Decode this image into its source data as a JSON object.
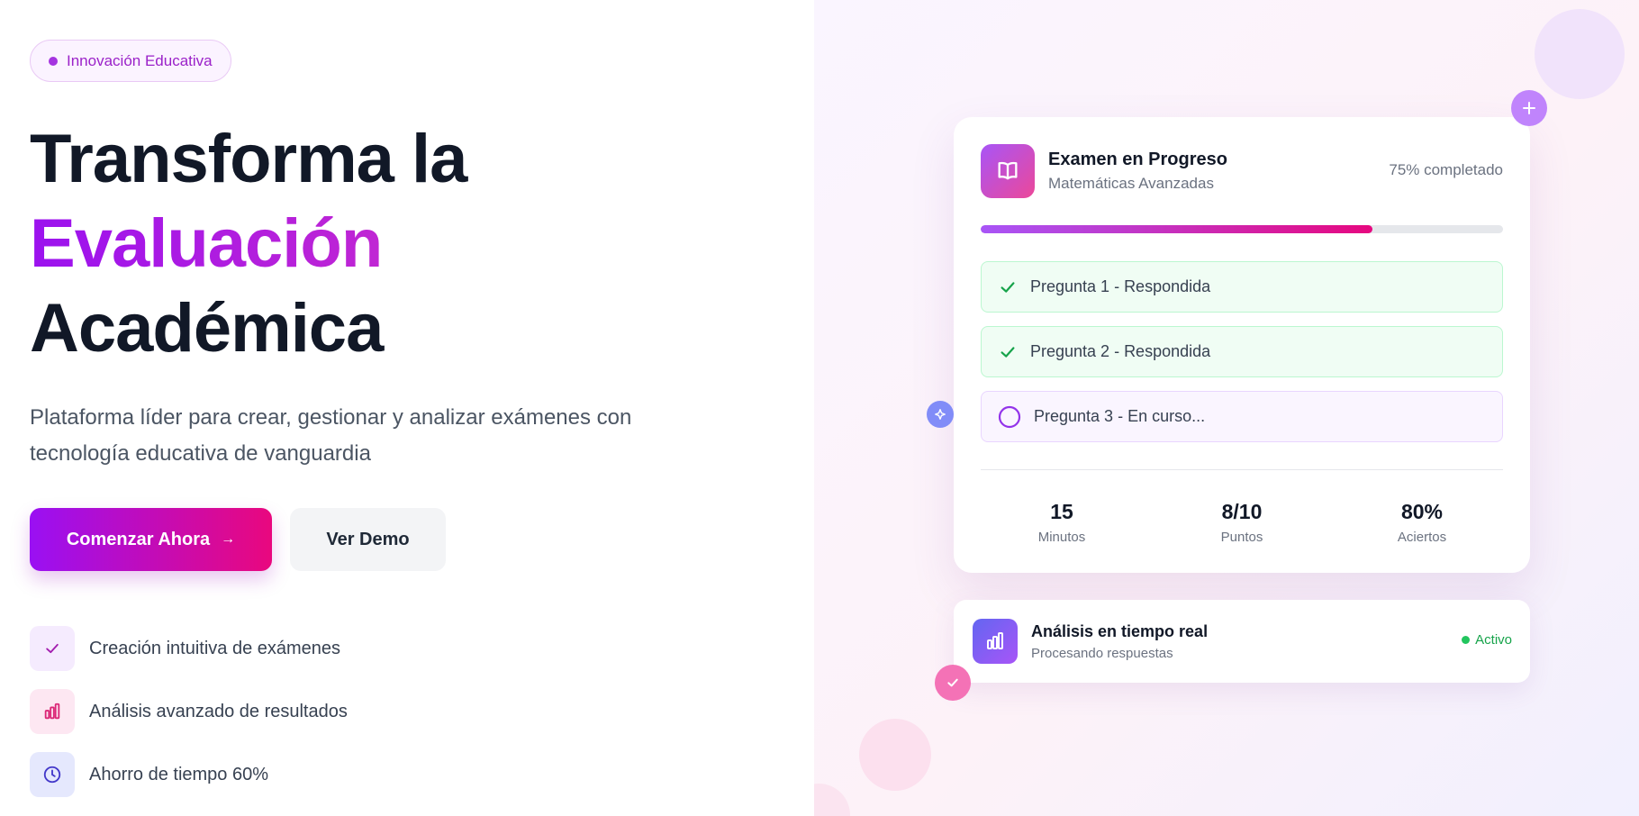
{
  "badge": {
    "label": "Innovación Educativa"
  },
  "hero": {
    "line1": "Transforma la",
    "line2": "Evaluación",
    "line3": "Académica",
    "subtitle": "Plataforma líder para crear, gestionar y analizar exámenes con tecnología educativa de vanguardia"
  },
  "buttons": {
    "primary": "Comenzar Ahora",
    "primary_arrow": "→",
    "secondary": "Ver Demo"
  },
  "features": [
    {
      "label": "Creación intuitiva de exámenes",
      "icon": "check-icon"
    },
    {
      "label": "Análisis avanzado de resultados",
      "icon": "bar-chart-icon"
    },
    {
      "label": "Ahorro de tiempo 60%",
      "icon": "clock-icon"
    }
  ],
  "exam_card": {
    "title": "Examen en Progreso",
    "subtitle": "Matemáticas Avanzadas",
    "completion_text": "75% completado",
    "progress": 0.75,
    "questions": [
      {
        "label": "Pregunta 1 - Respondida",
        "status": "answered"
      },
      {
        "label": "Pregunta 2 - Respondida",
        "status": "answered"
      },
      {
        "label": "Pregunta 3 - En curso...",
        "status": "in-progress"
      }
    ],
    "stats": [
      {
        "value": "15",
        "label": "Minutos"
      },
      {
        "value": "8/10",
        "label": "Puntos"
      },
      {
        "value": "80%",
        "label": "Aciertos"
      }
    ]
  },
  "analysis_card": {
    "title": "Análisis en tiempo real",
    "subtitle": "Procesando respuestas",
    "status": "Activo"
  },
  "colors": {
    "brand_purple": "#9b12ef",
    "brand_pink": "#e9087e",
    "success_green": "#16a34a"
  }
}
